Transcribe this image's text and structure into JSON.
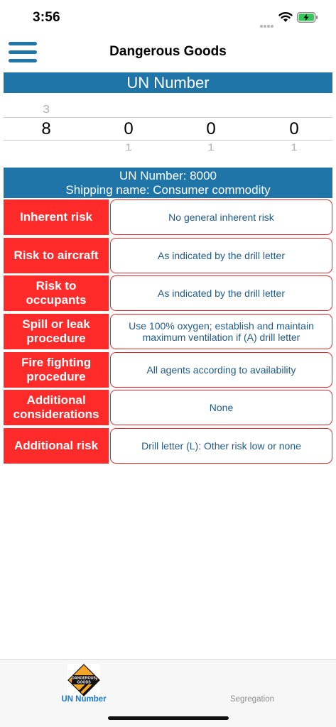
{
  "status_bar": {
    "time": "3:56"
  },
  "nav": {
    "title": "Dangerous Goods"
  },
  "section": {
    "title": "UN Number"
  },
  "picker": {
    "columns": [
      {
        "above": "3",
        "current": "8",
        "below": ""
      },
      {
        "above": "",
        "current": "0",
        "below": "1"
      },
      {
        "above": "",
        "current": "0",
        "below": "1"
      },
      {
        "above": "",
        "current": "0",
        "below": "1"
      }
    ]
  },
  "info": {
    "un_line": "UN Number: 8000",
    "name_line": "Shipping name: Consumer commodity"
  },
  "rows": [
    {
      "label": "Inherent risk",
      "value": "No general inherent risk"
    },
    {
      "label": "Risk to aircraft",
      "value": "As indicated by the drill letter"
    },
    {
      "label": "Risk to occupants",
      "value": "As indicated by the drill letter"
    },
    {
      "label": "Spill or leak procedure",
      "value": "Use 100% oxygen; establish and maintain maximum ventilation if (A) drill letter"
    },
    {
      "label": "Fire fighting procedure",
      "value": "All agents according to availability"
    },
    {
      "label": "Additional considerations",
      "value": "None"
    },
    {
      "label": "Additional risk",
      "value": "Drill letter (L): Other risk low or none"
    }
  ],
  "tabs": {
    "un_number": "UN Number",
    "segregation": "Segregation",
    "icon_text": "DANGEROUS GOODS"
  },
  "colors": {
    "accent_blue": "#1f74a8",
    "risk_red": "#ff2b2b",
    "tab_active": "#1a7bd6"
  }
}
